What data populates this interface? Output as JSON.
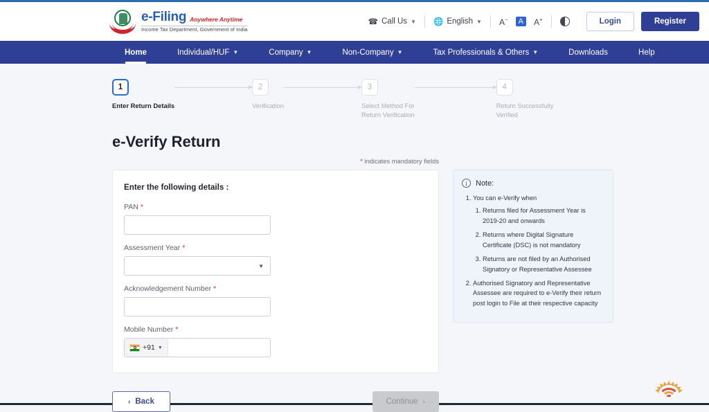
{
  "header": {
    "logo": {
      "title": "e-Filing",
      "tagline": "Anywhere Anytime",
      "department": "Income Tax Department, Government of India"
    },
    "call_us": "Call Us",
    "language": "English",
    "font_decrease": "A",
    "font_normal": "A",
    "font_increase": "A",
    "login": "Login",
    "register": "Register"
  },
  "nav": {
    "items": [
      {
        "label": "Home",
        "caret": false,
        "active": true
      },
      {
        "label": "Individual/HUF",
        "caret": true,
        "active": false
      },
      {
        "label": "Company",
        "caret": true,
        "active": false
      },
      {
        "label": "Non-Company",
        "caret": true,
        "active": false
      },
      {
        "label": "Tax Professionals & Others",
        "caret": true,
        "active": false
      },
      {
        "label": "Downloads",
        "caret": false,
        "active": false
      },
      {
        "label": "Help",
        "caret": false,
        "active": false
      }
    ]
  },
  "stepper": {
    "steps": [
      {
        "number": "1",
        "label": "Enter Return Details",
        "state": "current"
      },
      {
        "number": "2",
        "label": "Verification",
        "state": "upcoming"
      },
      {
        "number": "3",
        "label": "Select Method For\nReturn Verification",
        "state": "upcoming"
      },
      {
        "number": "4",
        "label": "Return Successfully\nVerified",
        "state": "upcoming"
      }
    ]
  },
  "main": {
    "page_title": "e-Verify Return",
    "mandatory_note": "indicates mandatory fields",
    "mandatory_star": "*",
    "form": {
      "heading": "Enter the following details :",
      "pan": {
        "label": "PAN",
        "value": "",
        "placeholder": ""
      },
      "assessment_year": {
        "label": "Assessment Year",
        "value": "",
        "placeholder": ""
      },
      "acknowledgement_number": {
        "label": "Acknowledgement Number",
        "value": "",
        "placeholder": ""
      },
      "mobile_number": {
        "label": "Mobile Number",
        "country_code": "+91",
        "value": "",
        "placeholder": ""
      },
      "required_marker": "*"
    },
    "note": {
      "title": "Note:",
      "items": [
        {
          "text": "You can e-Verify when",
          "sub": [
            "Returns filed for Assessment Year is 2019-20 and onwards",
            "Returns where Digital Signature Certificate (DSC) is not mandatory",
            "Returns are not filed by an Authorised Signatory or Representative Assessee"
          ]
        },
        {
          "text": "Authorised Signatory and Representative Assessee are required to e-Verify their return post login to File at their respective capacity",
          "sub": []
        }
      ]
    },
    "actions": {
      "back": "Back",
      "back_chevron": "‹",
      "continue": "Continue",
      "continue_chevron": "›"
    }
  },
  "colors": {
    "nav_blue": "#2f3f95",
    "accent_blue": "#2a6cd4",
    "brand_blue": "#2a5db0",
    "brand_red": "#d2232a",
    "required_red": "#e0263c",
    "note_bg": "#eef4fa",
    "page_bg": "#f5f6fa",
    "disabled_gray": "#c9cace"
  }
}
